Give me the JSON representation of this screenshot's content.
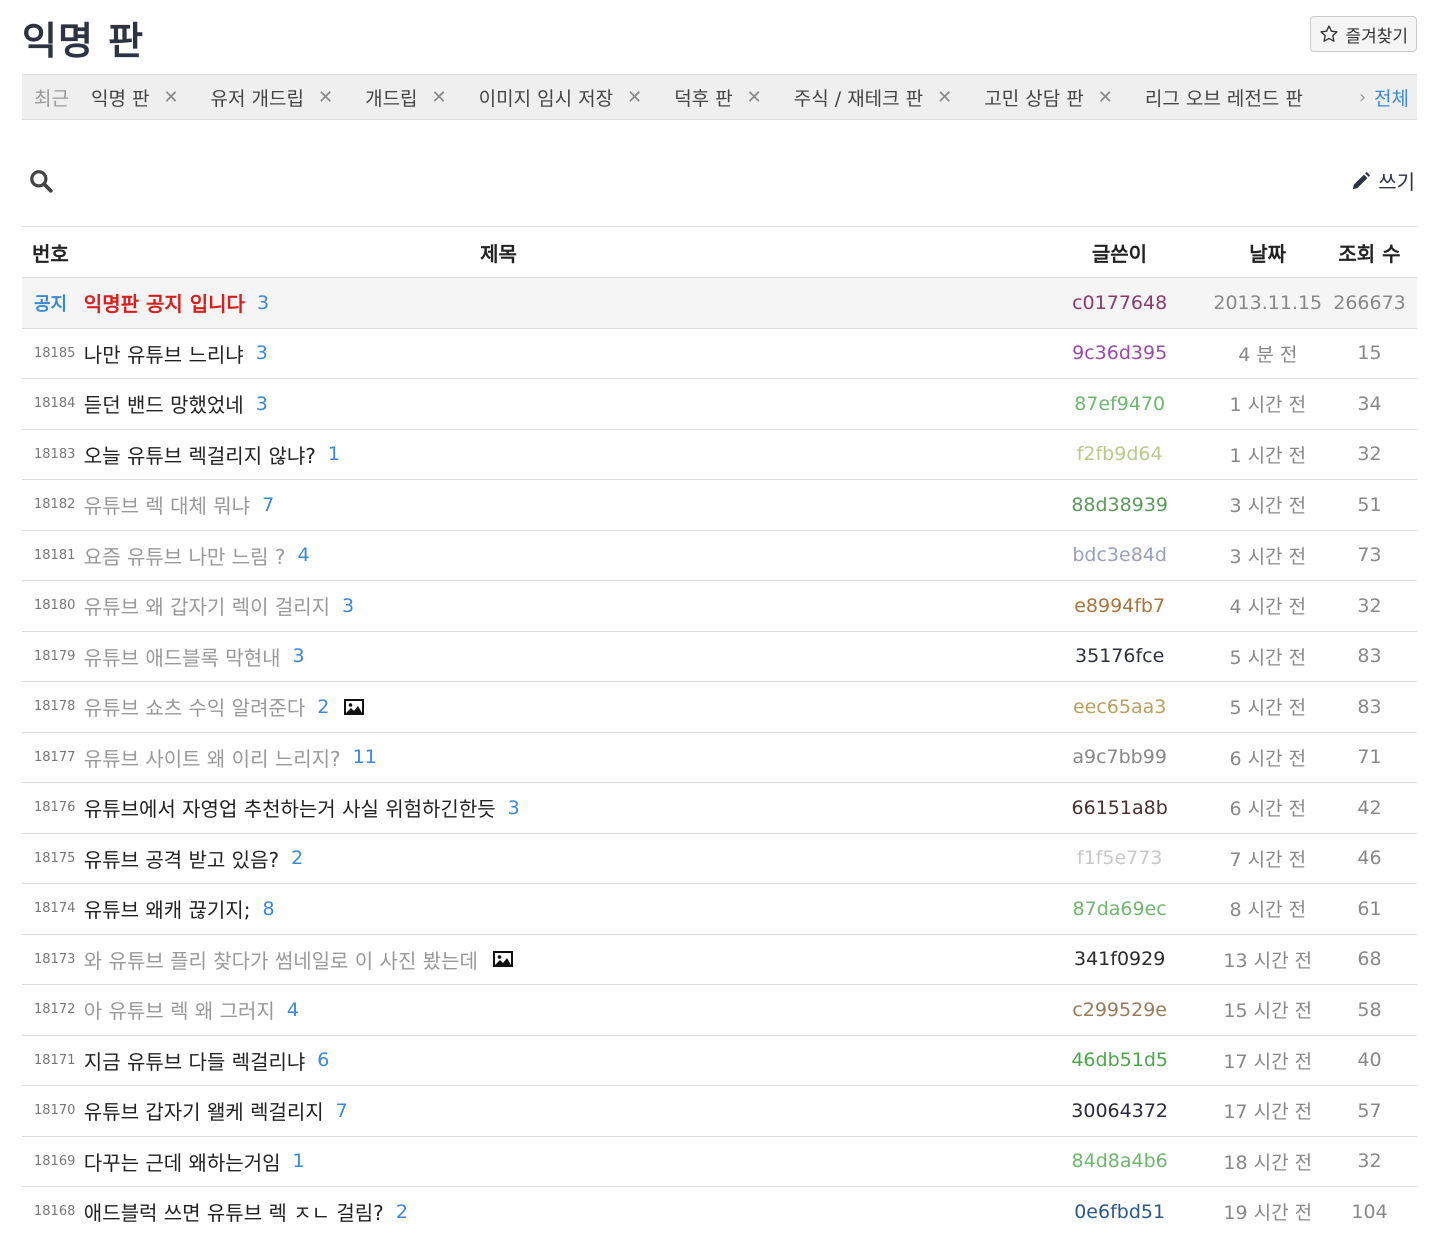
{
  "board": {
    "title": "익명 판",
    "favorite_label": "즐겨찾기"
  },
  "recent": {
    "label": "최근",
    "items": [
      "익명 판",
      "유저 개드립",
      "개드립",
      "이미지 임시 저장",
      "덕후 판",
      "주식 / 재테크 판",
      "고민 상담 판",
      "리그 오브 레전드 판"
    ],
    "more_chevron": "›",
    "all_label": "전체"
  },
  "tools": {
    "write_label": "쓰기"
  },
  "table": {
    "headers": {
      "no": "번호",
      "title": "제목",
      "author": "글쓴이",
      "date": "날짜",
      "views": "조회 수"
    },
    "notice": {
      "no": "공지",
      "title": "익명판 공지 입니다",
      "comments": "3",
      "author": "c0177648",
      "author_color": "#8a3a6a",
      "date": "2013.11.15",
      "views": "266673"
    },
    "rows": [
      {
        "no": "18185",
        "title": "나만 유튜브 느리냐",
        "comments": "3",
        "author": "9c36d395",
        "author_color": "#9a4aa8",
        "date": "4 분 전",
        "views": "15",
        "read": false,
        "image": false
      },
      {
        "no": "18184",
        "title": "듣던 밴드 망했었네",
        "comments": "3",
        "author": "87ef9470",
        "author_color": "#6db86d",
        "date": "1 시간 전",
        "views": "34",
        "read": false,
        "image": false
      },
      {
        "no": "18183",
        "title": "오늘 유튜브 렉걸리지 않냐?",
        "comments": "1",
        "author": "f2fb9d64",
        "author_color": "#b8c98a",
        "date": "1 시간 전",
        "views": "32",
        "read": false,
        "image": false
      },
      {
        "no": "18182",
        "title": "유튜브 렉 대체 뭐냐",
        "comments": "7",
        "author": "88d38939",
        "author_color": "#5a9a5a",
        "date": "3 시간 전",
        "views": "51",
        "read": true,
        "image": false
      },
      {
        "no": "18181",
        "title": "요즘 유튜브 나만 느림 ?",
        "comments": "4",
        "author": "bdc3e84d",
        "author_color": "#9aa0b8",
        "date": "3 시간 전",
        "views": "73",
        "read": true,
        "image": false
      },
      {
        "no": "18180",
        "title": "유튜브 왜 갑자기 렉이 걸리지",
        "comments": "3",
        "author": "e8994fb7",
        "author_color": "#a8743a",
        "date": "4 시간 전",
        "views": "32",
        "read": true,
        "image": false
      },
      {
        "no": "18179",
        "title": "유튜브 애드블록 막현내",
        "comments": "3",
        "author": "35176fce",
        "author_color": "#2d3040",
        "date": "5 시간 전",
        "views": "83",
        "read": true,
        "image": false
      },
      {
        "no": "18178",
        "title": "유튜브 쇼츠 수익 알려준다",
        "comments": "2",
        "author": "eec65aa3",
        "author_color": "#b8a060",
        "date": "5 시간 전",
        "views": "83",
        "read": true,
        "image": true
      },
      {
        "no": "18177",
        "title": "유튜브 사이트 왜 이리 느리지?",
        "comments": "11",
        "author": "a9c7bb99",
        "author_color": "#888888",
        "date": "6 시간 전",
        "views": "71",
        "read": true,
        "image": false
      },
      {
        "no": "18176",
        "title": "유튜브에서 자영업 추천하는거 사실 위험하긴한듯",
        "comments": "3",
        "author": "66151a8b",
        "author_color": "#4a3030",
        "date": "6 시간 전",
        "views": "42",
        "read": false,
        "image": false
      },
      {
        "no": "18175",
        "title": "유튜브 공격 받고 있음?",
        "comments": "2",
        "author": "f1f5e773",
        "author_color": "#c8c8c8",
        "date": "7 시간 전",
        "views": "46",
        "read": false,
        "image": false
      },
      {
        "no": "18174",
        "title": "유튜브 왜캐 끊기지;",
        "comments": "8",
        "author": "87da69ec",
        "author_color": "#6db86d",
        "date": "8 시간 전",
        "views": "61",
        "read": false,
        "image": false
      },
      {
        "no": "18173",
        "title": "와 유튜브 플리 찾다가 썸네일로 이 사진 봤는데",
        "comments": "",
        "author": "341f0929",
        "author_color": "#2a2a2a",
        "date": "13 시간 전",
        "views": "68",
        "read": true,
        "image": true
      },
      {
        "no": "18172",
        "title": "아 유튜브 렉 왜 그러지",
        "comments": "4",
        "author": "c299529e",
        "author_color": "#9a7a5a",
        "date": "15 시간 전",
        "views": "58",
        "read": true,
        "image": false
      },
      {
        "no": "18171",
        "title": "지금 유튜브 다들 렉걸리냐",
        "comments": "6",
        "author": "46db51d5",
        "author_color": "#4aa84a",
        "date": "17 시간 전",
        "views": "40",
        "read": false,
        "image": false
      },
      {
        "no": "18170",
        "title": "유튜브 갑자기 왤케 렉걸리지",
        "comments": "7",
        "author": "30064372",
        "author_color": "#2a2a3a",
        "date": "17 시간 전",
        "views": "57",
        "read": false,
        "image": false
      },
      {
        "no": "18169",
        "title": "다꾸는 근데 왜하는거임",
        "comments": "1",
        "author": "84d8a4b6",
        "author_color": "#6db86d",
        "date": "18 시간 전",
        "views": "32",
        "read": false,
        "image": false
      },
      {
        "no": "18168",
        "title": "애드블럭 쓰면 유튜브 렉 ㅈㄴ 걸림?",
        "comments": "2",
        "author": "0e6fbd51",
        "author_color": "#2a5a8a",
        "date": "19 시간 전",
        "views": "104",
        "read": false,
        "image": false
      }
    ]
  }
}
